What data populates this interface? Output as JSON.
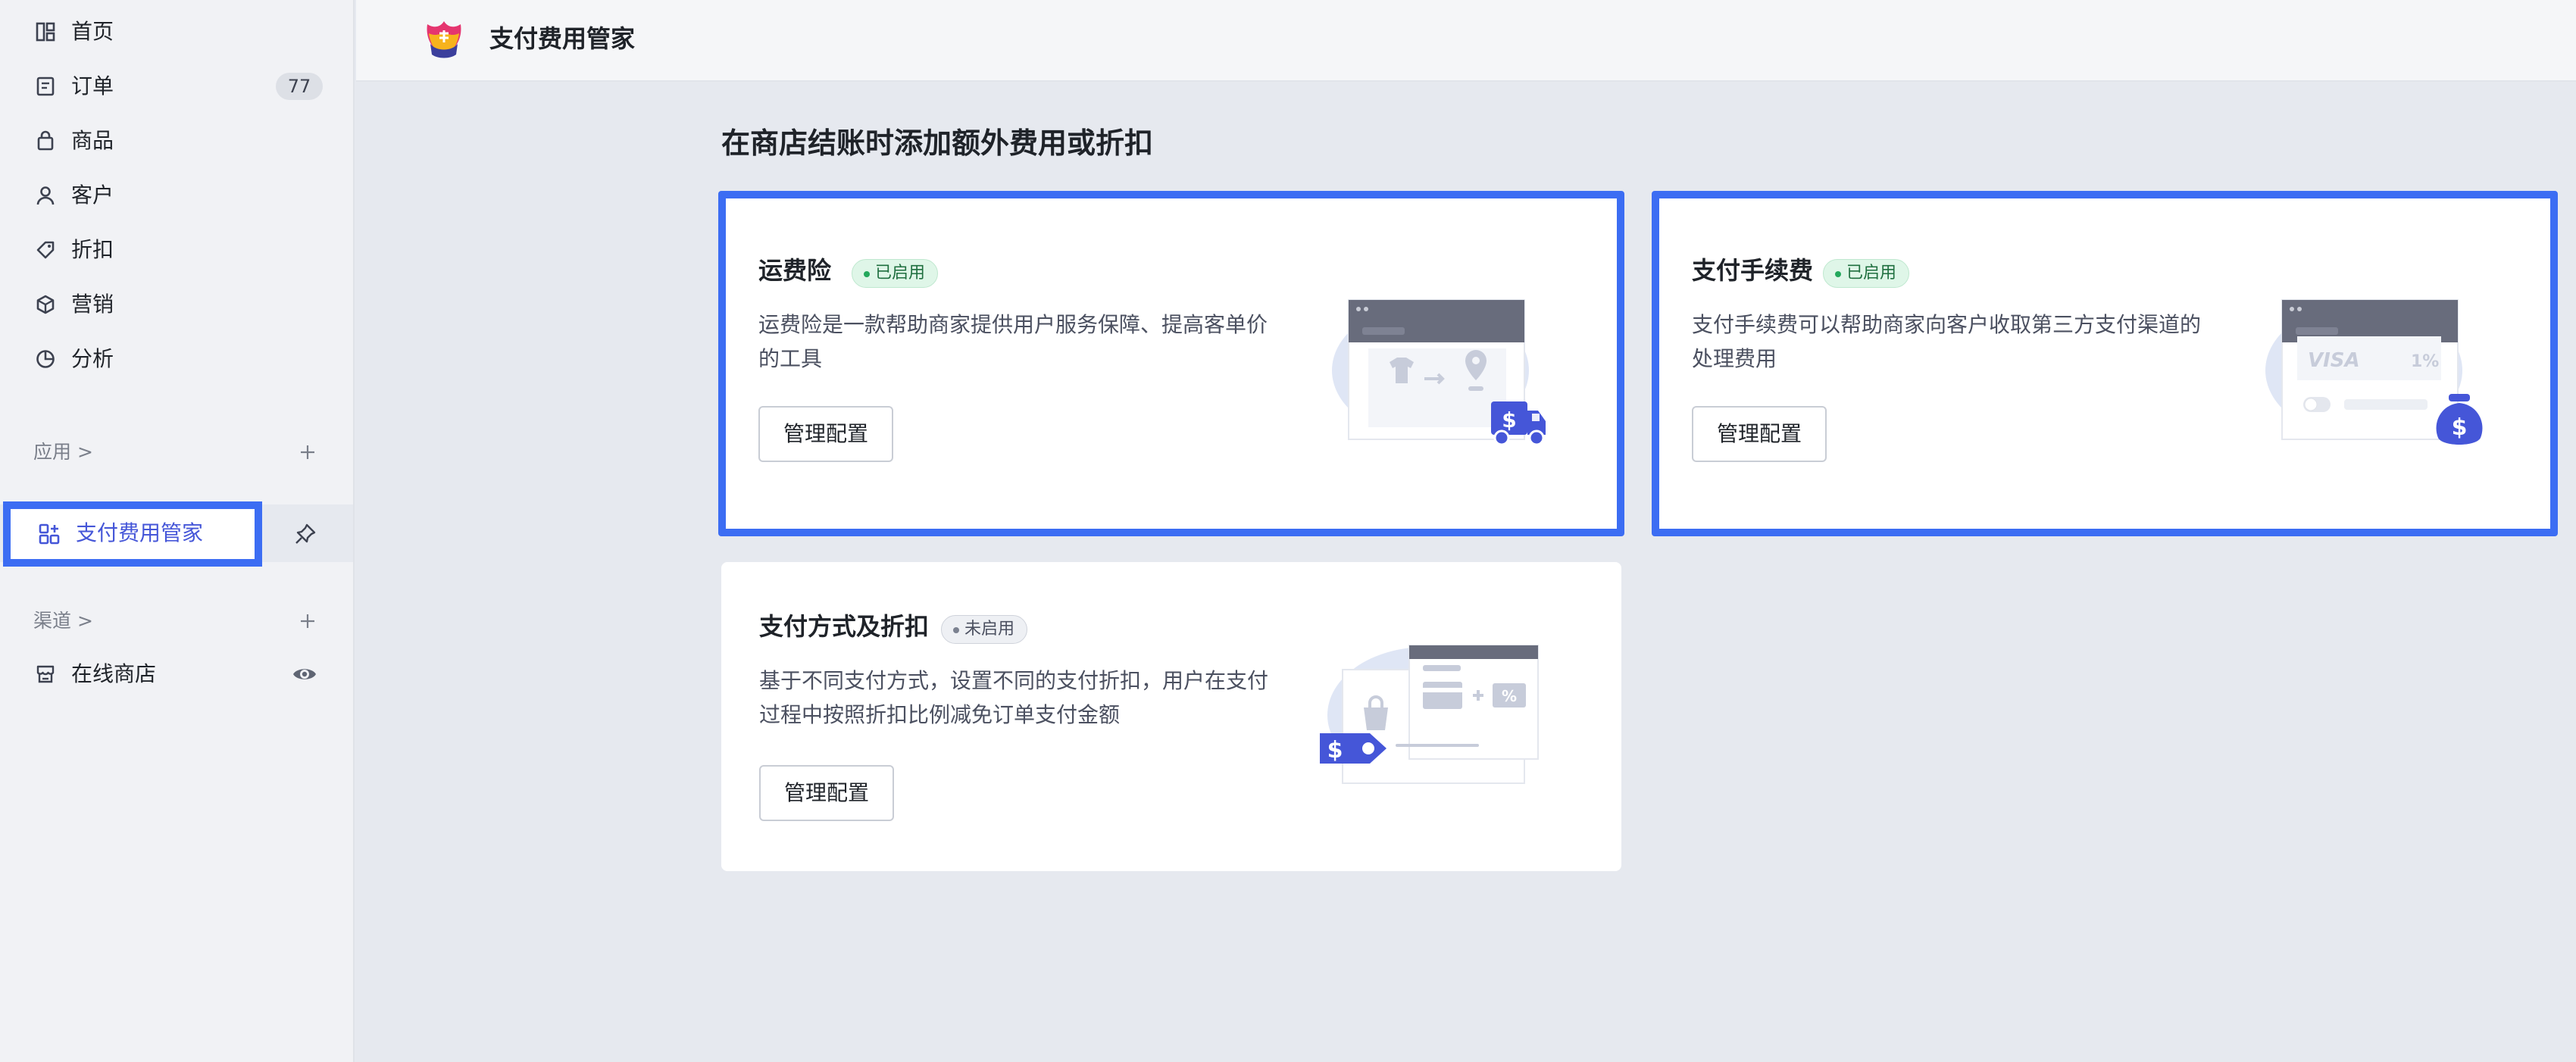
{
  "sidebar": {
    "items": [
      {
        "label": "首页",
        "icon": "dashboard-icon"
      },
      {
        "label": "订单",
        "icon": "order-icon",
        "count": "77"
      },
      {
        "label": "商品",
        "icon": "bag-icon"
      },
      {
        "label": "客户",
        "icon": "user-icon"
      },
      {
        "label": "折扣",
        "icon": "tag-icon"
      },
      {
        "label": "营销",
        "icon": "cube-icon"
      },
      {
        "label": "分析",
        "icon": "pie-chart-icon"
      }
    ],
    "apps_section": "应用 >",
    "active_app": "支付费用管家",
    "channels_section": "渠道 >",
    "channel_item": "在线商店"
  },
  "header": {
    "title": "支付费用管家"
  },
  "main": {
    "heading": "在商店结账时添加额外费用或折扣",
    "cards": [
      {
        "title": "运费险",
        "status": "已启用",
        "description": "运费险是一款帮助商家提供用户服务保障、提高客单价的工具",
        "button": "管理配置"
      },
      {
        "title": "支付手续费",
        "status": "已启用",
        "description": "支付手续费可以帮助商家向客户收取第三方支付渠道的处理费用",
        "button": "管理配置",
        "illustration_text": {
          "brand": "VISA",
          "rate": "1%"
        }
      },
      {
        "title": "支付方式及折扣",
        "status": "未启用",
        "description": "基于不同支付方式，设置不同的支付折扣，用户在支付过程中按照折扣比例减免订单支付金额",
        "button": "管理配置",
        "illustration_text": {
          "percent": "%"
        }
      }
    ]
  },
  "colors": {
    "accent": "#3c6df3",
    "illustration_blue": "#4556d8",
    "enabled_green": "#24a85c",
    "page_bg": "#e6e9ef"
  }
}
